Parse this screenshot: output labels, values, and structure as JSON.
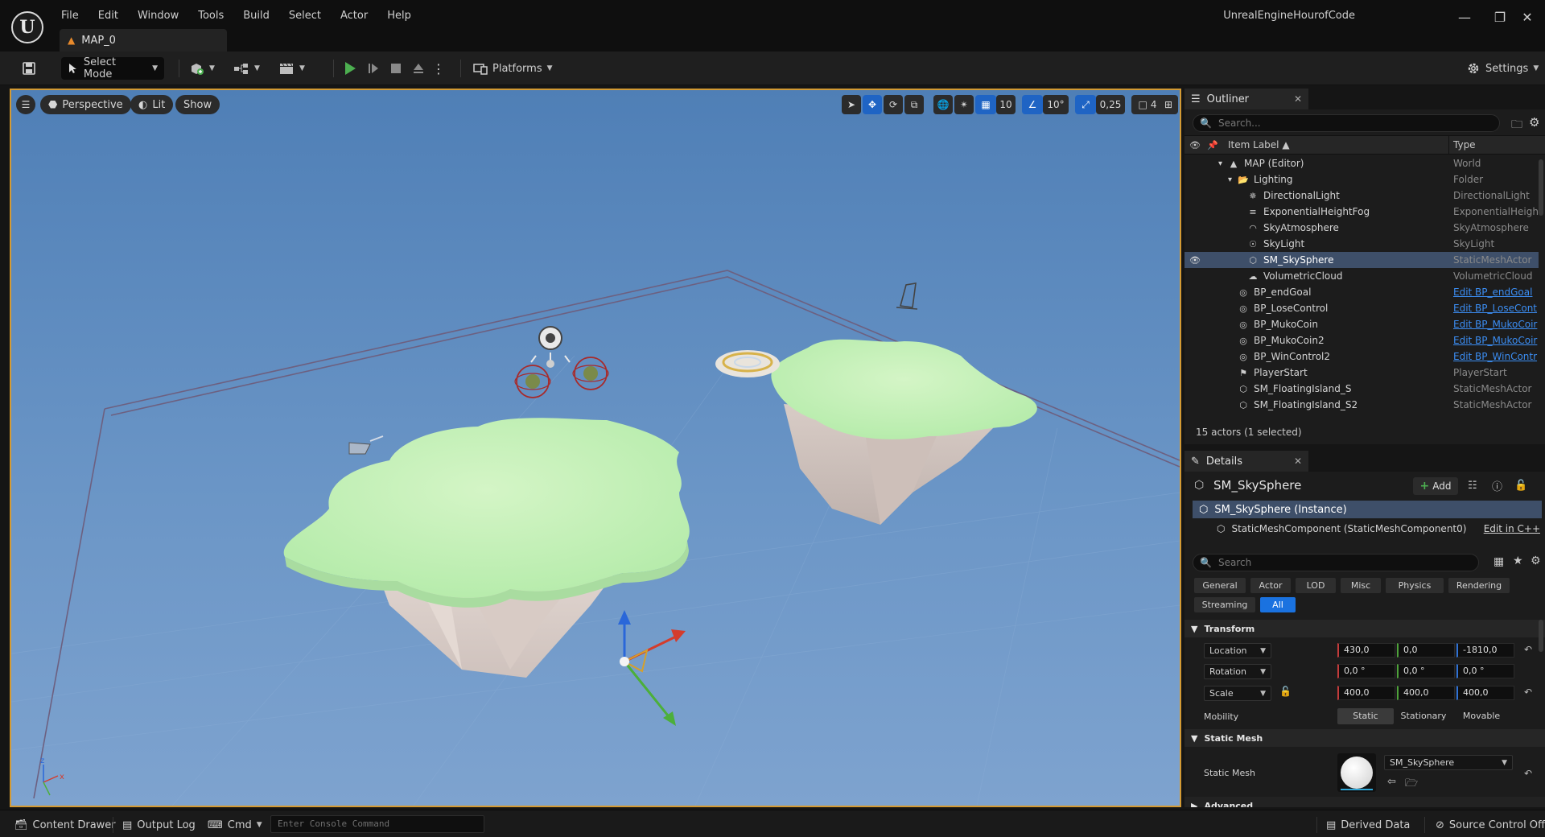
{
  "app": {
    "logo": "U",
    "project_name": "UnrealEngineHourofCode",
    "menu": [
      "File",
      "Edit",
      "Window",
      "Tools",
      "Build",
      "Select",
      "Actor",
      "Help"
    ],
    "map_tab": "MAP_0"
  },
  "toolbar": {
    "select_mode": "Select Mode",
    "platforms": "Platforms",
    "settings": "Settings",
    "play_color": "#4caf50"
  },
  "viewport": {
    "perspective": "Perspective",
    "lit": "Lit",
    "show": "Show",
    "grid_snap": "10",
    "rotation_snap": "10°",
    "scale_snap": "0,25",
    "camera_speed": "4",
    "accent_color": "#d39a34"
  },
  "outliner": {
    "tab_label": "Outliner",
    "search_placeholder": "Search...",
    "col_label": "Item Label",
    "col_type": "Type",
    "rows": [
      {
        "label": "MAP (Editor)",
        "type": "World",
        "icon": "map-icon",
        "indent": 0,
        "link": false,
        "selected": false,
        "eye": false
      },
      {
        "label": "Lighting",
        "type": "Folder",
        "icon": "folder-icon",
        "indent": 1,
        "link": false,
        "selected": false,
        "eye": false
      },
      {
        "label": "DirectionalLight",
        "type": "DirectionalLight",
        "icon": "directional-light-icon",
        "indent": 2,
        "link": false,
        "selected": false,
        "eye": false
      },
      {
        "label": "ExponentialHeightFog",
        "type": "ExponentialHeight",
        "icon": "fog-icon",
        "indent": 2,
        "link": false,
        "selected": false,
        "eye": false
      },
      {
        "label": "SkyAtmosphere",
        "type": "SkyAtmosphere",
        "icon": "sky-atmosphere-icon",
        "indent": 2,
        "link": false,
        "selected": false,
        "eye": false
      },
      {
        "label": "SkyLight",
        "type": "SkyLight",
        "icon": "sky-light-icon",
        "indent": 2,
        "link": false,
        "selected": false,
        "eye": false
      },
      {
        "label": "SM_SkySphere",
        "type": "StaticMeshActor",
        "icon": "static-mesh-icon",
        "indent": 2,
        "link": false,
        "selected": true,
        "eye": true
      },
      {
        "label": "VolumetricCloud",
        "type": "VolumetricCloud",
        "icon": "cloud-icon",
        "indent": 2,
        "link": false,
        "selected": false,
        "eye": false
      },
      {
        "label": "BP_endGoal",
        "type": "Edit BP_endGoal",
        "icon": "blueprint-icon",
        "indent": 1,
        "link": true,
        "selected": false,
        "eye": false
      },
      {
        "label": "BP_LoseControl",
        "type": "Edit BP_LoseCont",
        "icon": "blueprint-icon",
        "indent": 1,
        "link": true,
        "selected": false,
        "eye": false
      },
      {
        "label": "BP_MukoCoin",
        "type": "Edit BP_MukoCoir",
        "icon": "blueprint-icon",
        "indent": 1,
        "link": true,
        "selected": false,
        "eye": false
      },
      {
        "label": "BP_MukoCoin2",
        "type": "Edit BP_MukoCoir",
        "icon": "blueprint-icon",
        "indent": 1,
        "link": true,
        "selected": false,
        "eye": false
      },
      {
        "label": "BP_WinControl2",
        "type": "Edit BP_WinContr",
        "icon": "blueprint-icon",
        "indent": 1,
        "link": true,
        "selected": false,
        "eye": false
      },
      {
        "label": "PlayerStart",
        "type": "PlayerStart",
        "icon": "player-start-icon",
        "indent": 1,
        "link": false,
        "selected": false,
        "eye": false
      },
      {
        "label": "SM_FloatingIsland_S",
        "type": "StaticMeshActor",
        "icon": "static-mesh-icon",
        "indent": 1,
        "link": false,
        "selected": false,
        "eye": false
      },
      {
        "label": "SM_FloatingIsland_S2",
        "type": "StaticMeshActor",
        "icon": "static-mesh-icon",
        "indent": 1,
        "link": false,
        "selected": false,
        "eye": false
      }
    ],
    "footer": "15 actors (1 selected)"
  },
  "details": {
    "tab_label": "Details",
    "actor_name": "SM_SkySphere",
    "add_label": "Add",
    "instance_label": "SM_SkySphere (Instance)",
    "component_label": "StaticMeshComponent (StaticMeshComponent0)",
    "edit_cpp": "Edit in C++",
    "search_placeholder": "Search",
    "categories": [
      "General",
      "Actor",
      "LOD",
      "Misc",
      "Physics",
      "Rendering",
      "Streaming",
      "All"
    ],
    "active_category": "All",
    "transform": {
      "header": "Transform",
      "location_label": "Location",
      "rotation_label": "Rotation",
      "scale_label": "Scale",
      "location": [
        "430,0",
        "0,0",
        "-1810,0"
      ],
      "rotation": [
        "0,0 °",
        "0,0 °",
        "0,0 °"
      ],
      "scale": [
        "400,0",
        "400,0",
        "400,0"
      ],
      "mobility_label": "Mobility",
      "mobility_options": [
        "Static",
        "Stationary",
        "Movable"
      ],
      "mobility_selected": "Static"
    },
    "static_mesh": {
      "header": "Static Mesh",
      "label": "Static Mesh",
      "value": "SM_SkySphere"
    },
    "advanced_label": "Advanced"
  },
  "statusbar": {
    "content_drawer": "Content Drawer",
    "output_log": "Output Log",
    "cmd": "Cmd",
    "console_placeholder": "Enter Console Command",
    "derived_data": "Derived Data",
    "source_control": "Source Control Off"
  }
}
